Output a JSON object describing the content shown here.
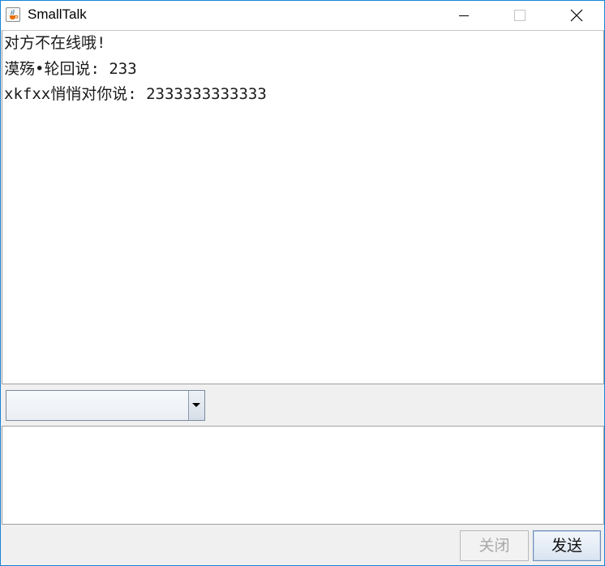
{
  "window": {
    "title": "SmallTalk"
  },
  "chat": {
    "messages": [
      "对方不在线哦!",
      "漠殇•轮回说: 233",
      "xkfxx悄悄对你说: 2333333333333"
    ]
  },
  "recipient_select": {
    "selected": ""
  },
  "message_input": {
    "value": ""
  },
  "buttons": {
    "close_label": "关闭",
    "send_label": "发送"
  },
  "icons": {
    "app": "java-coffee-icon",
    "minimize": "minimize-icon",
    "maximize": "maximize-icon",
    "close": "close-icon",
    "dropdown": "dropdown-arrow-icon"
  },
  "colors": {
    "window_border": "#1883d7",
    "panel_background": "#f0f0f0",
    "disabled_text": "#a8a8a8"
  }
}
